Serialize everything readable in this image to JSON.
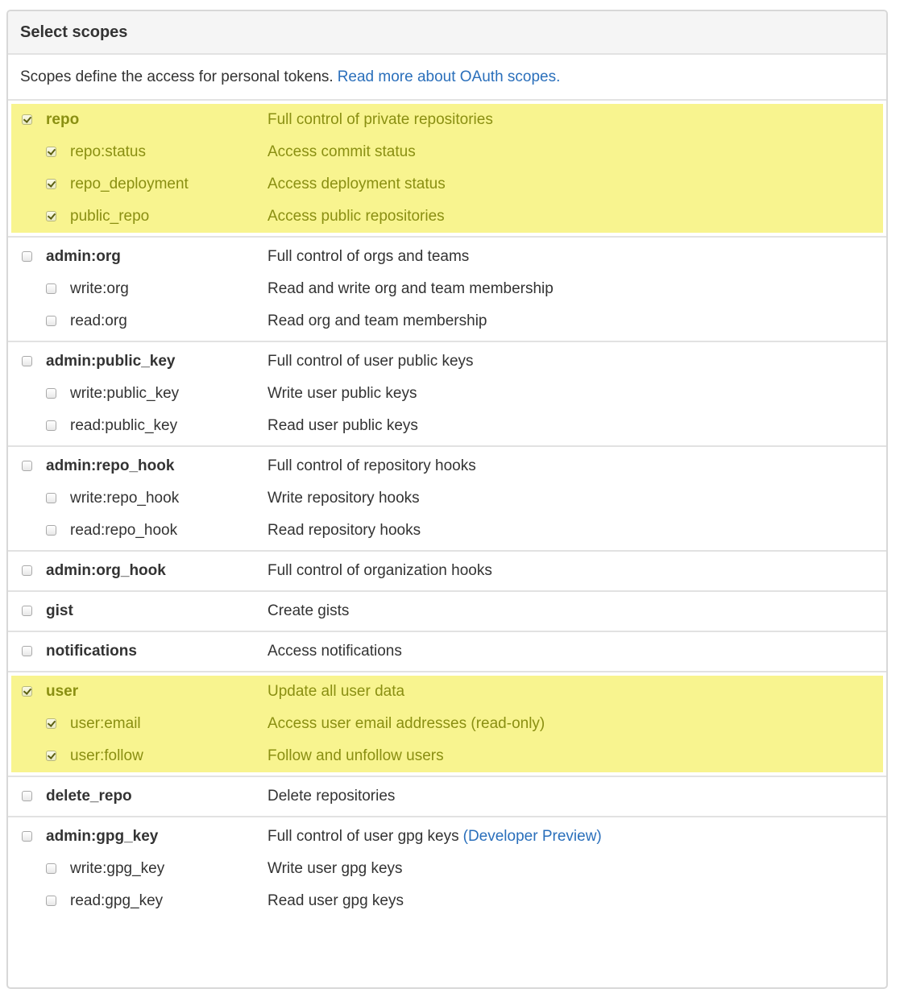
{
  "header": {
    "title": "Select scopes"
  },
  "intro": {
    "text": "Scopes define the access for personal tokens.",
    "link": "Read more about OAuth scopes."
  },
  "groups": [
    {
      "id": "repo",
      "selected": true,
      "scopes": [
        {
          "name": "repo",
          "desc": "Full control of private repositories",
          "checked": true,
          "level": "parent"
        },
        {
          "name": "repo:status",
          "desc": "Access commit status",
          "checked": true,
          "level": "child"
        },
        {
          "name": "repo_deployment",
          "desc": "Access deployment status",
          "checked": true,
          "level": "child"
        },
        {
          "name": "public_repo",
          "desc": "Access public repositories",
          "checked": true,
          "level": "child"
        }
      ]
    },
    {
      "id": "admin-org",
      "selected": false,
      "scopes": [
        {
          "name": "admin:org",
          "desc": "Full control of orgs and teams",
          "checked": false,
          "level": "parent"
        },
        {
          "name": "write:org",
          "desc": "Read and write org and team membership",
          "checked": false,
          "level": "child"
        },
        {
          "name": "read:org",
          "desc": "Read org and team membership",
          "checked": false,
          "level": "child"
        }
      ]
    },
    {
      "id": "admin-public-key",
      "selected": false,
      "scopes": [
        {
          "name": "admin:public_key",
          "desc": "Full control of user public keys",
          "checked": false,
          "level": "parent"
        },
        {
          "name": "write:public_key",
          "desc": "Write user public keys",
          "checked": false,
          "level": "child"
        },
        {
          "name": "read:public_key",
          "desc": "Read user public keys",
          "checked": false,
          "level": "child"
        }
      ]
    },
    {
      "id": "admin-repo-hook",
      "selected": false,
      "scopes": [
        {
          "name": "admin:repo_hook",
          "desc": "Full control of repository hooks",
          "checked": false,
          "level": "parent"
        },
        {
          "name": "write:repo_hook",
          "desc": "Write repository hooks",
          "checked": false,
          "level": "child"
        },
        {
          "name": "read:repo_hook",
          "desc": "Read repository hooks",
          "checked": false,
          "level": "child"
        }
      ]
    },
    {
      "id": "admin-org-hook",
      "selected": false,
      "scopes": [
        {
          "name": "admin:org_hook",
          "desc": "Full control of organization hooks",
          "checked": false,
          "level": "parent"
        }
      ]
    },
    {
      "id": "gist",
      "selected": false,
      "scopes": [
        {
          "name": "gist",
          "desc": "Create gists",
          "checked": false,
          "level": "parent"
        }
      ]
    },
    {
      "id": "notifications",
      "selected": false,
      "scopes": [
        {
          "name": "notifications",
          "desc": "Access notifications",
          "checked": false,
          "level": "parent"
        }
      ]
    },
    {
      "id": "user",
      "selected": true,
      "scopes": [
        {
          "name": "user",
          "desc": "Update all user data",
          "checked": true,
          "level": "parent"
        },
        {
          "name": "user:email",
          "desc": "Access user email addresses (read-only)",
          "checked": true,
          "level": "child"
        },
        {
          "name": "user:follow",
          "desc": "Follow and unfollow users",
          "checked": true,
          "level": "child"
        }
      ]
    },
    {
      "id": "delete-repo",
      "selected": false,
      "scopes": [
        {
          "name": "delete_repo",
          "desc": "Delete repositories",
          "checked": false,
          "level": "parent"
        }
      ]
    },
    {
      "id": "admin-gpg-key",
      "selected": false,
      "scopes": [
        {
          "name": "admin:gpg_key",
          "desc": "Full control of user gpg keys",
          "desc_link": "(Developer Preview)",
          "checked": false,
          "level": "parent"
        },
        {
          "name": "write:gpg_key",
          "desc": "Write user gpg keys",
          "checked": false,
          "level": "child"
        },
        {
          "name": "read:gpg_key",
          "desc": "Read user gpg keys",
          "checked": false,
          "level": "child"
        }
      ]
    }
  ],
  "colors": {
    "highlight": "#f8f48f",
    "highlight_text": "#8a8f12",
    "link": "#2a6fbb",
    "border": "#e2e2e2"
  }
}
